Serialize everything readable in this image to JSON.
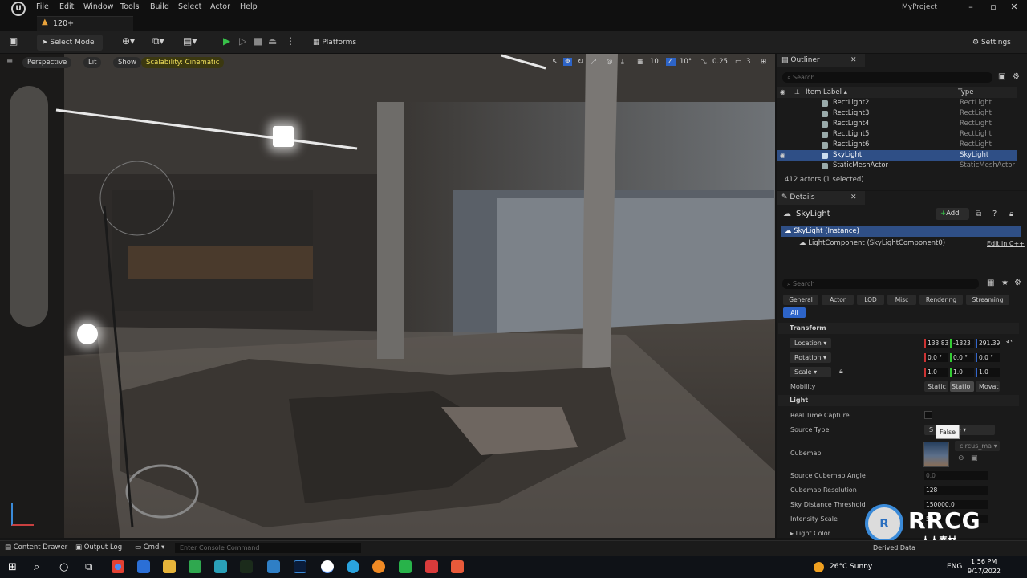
{
  "menu": {
    "items": [
      "File",
      "Edit",
      "Window",
      "Tools",
      "Build",
      "Select",
      "Actor",
      "Help"
    ],
    "project": "MyProject"
  },
  "level_tab": {
    "label": "120+"
  },
  "toolbar": {
    "select_mode": "Select Mode",
    "platforms": "Platforms",
    "settings": "Settings"
  },
  "viewport": {
    "perspective": "Perspective",
    "lit": "Lit",
    "show": "Show",
    "scalability": "Scalability: Cinematic",
    "grid": "10",
    "rotation": "10°",
    "scale": "0.25",
    "camera_speed": "3"
  },
  "outliner": {
    "tab": "Outliner",
    "search_placeholder": "Search",
    "col_label": "Item Label ▴",
    "col_type": "Type",
    "rows": [
      {
        "label": "RectLight2",
        "type": "RectLight"
      },
      {
        "label": "RectLight3",
        "type": "RectLight"
      },
      {
        "label": "RectLight4",
        "type": "RectLight"
      },
      {
        "label": "RectLight5",
        "type": "RectLight"
      },
      {
        "label": "RectLight6",
        "type": "RectLight"
      },
      {
        "label": "SkyLight",
        "type": "SkyLight"
      },
      {
        "label": "StaticMeshActor",
        "type": "StaticMeshActor"
      }
    ],
    "count": "412 actors (1 selected)"
  },
  "details": {
    "tab": "Details",
    "actor_name": "SkyLight",
    "add_label": "Add",
    "instance": "SkyLight (Instance)",
    "component": "LightComponent (SkyLightComponent0)",
    "edit_cpp": "Edit in C++",
    "search_placeholder": "Search",
    "filters": [
      "General",
      "Actor",
      "LOD",
      "Misc",
      "Rendering",
      "Streaming",
      "All"
    ],
    "transform_section": "Transform",
    "location_label": "Location",
    "location": [
      "133.83",
      "-1323",
      "291.39"
    ],
    "rotation_label": "Rotation",
    "rotation": [
      "0.0 °",
      "0.0 °",
      "0.0 °"
    ],
    "scale_label": "Scale",
    "scale": [
      "1.0",
      "1.0",
      "1.0"
    ],
    "mobility_label": "Mobility",
    "mobility": [
      "Static",
      "Statio",
      "Movat"
    ],
    "light_section": "Light",
    "real_time_capture": "Real Time Capture",
    "tooltip": "False",
    "source_type": "Source Type",
    "source_type_value": "S       d Scene",
    "cubemap": "Cubemap",
    "cubemap_value": "circus_ma",
    "source_cubemap_angle": "Source Cubemap Angle",
    "source_cubemap_angle_value": "0.0",
    "cubemap_resolution": "Cubemap Resolution",
    "cubemap_resolution_value": "128",
    "sky_distance": "Sky Distance Threshold",
    "sky_distance_value": "150000.0",
    "intensity": "Intensity Scale",
    "intensity_value": "50",
    "light_color": "Light Color"
  },
  "bottom": {
    "content_drawer": "Content Drawer",
    "output_log": "Output Log",
    "cmd": "Cmd",
    "console_placeholder": "Enter Console Command",
    "derived_data": "Derived Data"
  },
  "taskbar": {
    "weather": "26°C  Sunny",
    "lang": "ENG",
    "time": "1:56 PM",
    "date": "9/17/2022"
  },
  "watermark": {
    "logo_text": "RRCG",
    "sub": "人人素材"
  },
  "colors": {
    "accent_blue": "#2d64c8",
    "selection": "#2f4f86",
    "scalability": "#f0e05a"
  }
}
